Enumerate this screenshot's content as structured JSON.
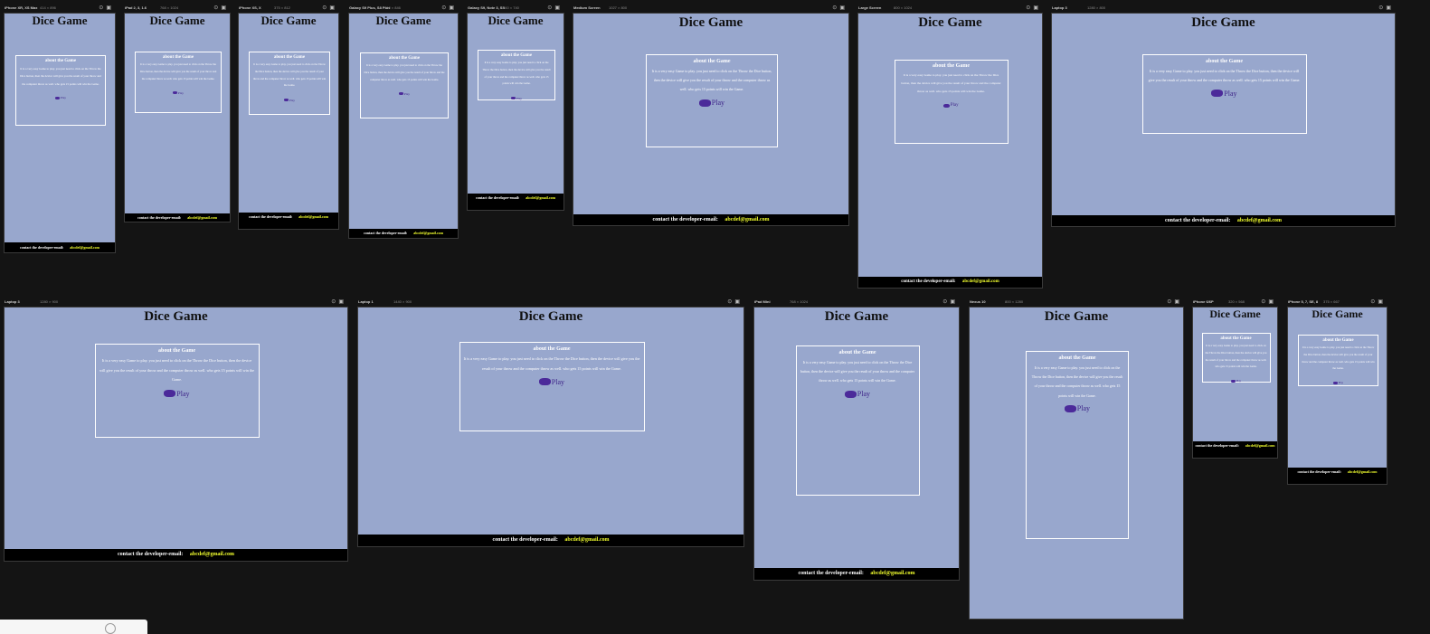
{
  "app": {
    "title": "Dice Game",
    "about_heading": "about the Game",
    "about_text": "It is a very easy Game to play. you just need to click on the Throw the Dice button, then the device will give you the result of your throw and the computer throw as well. who gets 15 points will win the Game.",
    "play_label": "Play",
    "footer_label": "contact the developer-email:",
    "footer_email": "abcdef@gmail.com"
  },
  "devices": [
    {
      "name": "iPhone XR, XS Max",
      "size": "414 × 896"
    },
    {
      "name": "iPad 2, 3, 1.6",
      "size": "768 × 1024"
    },
    {
      "name": "iPhone XS, X",
      "size": "375 × 812"
    },
    {
      "name": "Galaxy S9 Plus, S8 Plus",
      "size": "412 × 846"
    },
    {
      "name": "Galaxy S9, Note 3, S5",
      "size": "360 × 740"
    },
    {
      "name": "Medium Screen",
      "size": "1027 × 800"
    },
    {
      "name": "Large Screen",
      "size": "800 × 1024"
    },
    {
      "name": "Laptop 3",
      "size": "1280 × 800"
    },
    {
      "name": "Laptop 3",
      "size": "1280 × 900"
    },
    {
      "name": "Laptop 1",
      "size": "1440 × 900"
    },
    {
      "name": "iPad Mini",
      "size": "768 × 1024"
    },
    {
      "name": "Nexus 10",
      "size": "800 × 1280"
    },
    {
      "name": "iPhone 6/6P",
      "size": "320 × 568"
    },
    {
      "name": "iPhone 5, 7, SE, 8",
      "size": "375 × 667"
    }
  ]
}
